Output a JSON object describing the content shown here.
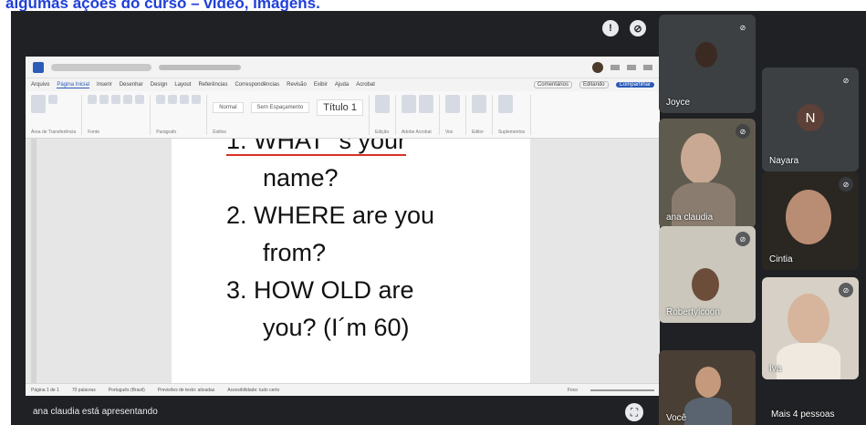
{
  "caption": "algumas ações do curso – vídeo, imagens.",
  "colors": {
    "caption_blue": "#1f3fd8",
    "meet_bg": "#202124",
    "word_blue": "#2b5bb8",
    "spell_red": "#d93025"
  },
  "share_icons": [
    "info-icon",
    "mic-off-icon"
  ],
  "word": {
    "tabs": [
      "Arquivo",
      "Página Inicial",
      "Inserir",
      "Desenhar",
      "Design",
      "Layout",
      "Referências",
      "Correspondências",
      "Revisão",
      "Exibir",
      "Ajuda",
      "Acrobat"
    ],
    "active_tab_index": 1,
    "comments_label": "Comentários",
    "editing_label": "Editando",
    "share_label": "Compartilhar",
    "styles": [
      "Normal",
      "Sem Espaçamento",
      "Título 1"
    ],
    "groups": [
      "Área de Transferência",
      "Fonte",
      "Parágrafo",
      "Estilos",
      "Edição",
      "Adobe Acrobat",
      "Voz",
      "Editor",
      "Suplementos"
    ],
    "doc_lines": [
      {
        "text": "1. WHAT ´s your",
        "underline": true,
        "indent": false
      },
      {
        "text": "name?",
        "underline": false,
        "indent": true
      },
      {
        "text": "2. WHERE are you",
        "underline": false,
        "indent": false
      },
      {
        "text": "from?",
        "underline": false,
        "indent": true
      },
      {
        "text": "3. HOW OLD are",
        "underline": false,
        "indent": false
      },
      {
        "text": "you? (I´m 60)",
        "underline": false,
        "indent": true
      }
    ],
    "status": {
      "page": "Página 1 de 1",
      "words": "70 palavras",
      "language": "Português (Brasil)",
      "text_predictions": "Previsões de texto: ativadas",
      "accessibility": "Acessibilidade: tudo certo",
      "focus": "Foco"
    }
  },
  "presenting_text": "ana claudia está apresentando",
  "participants": [
    {
      "name": "Joyce",
      "tile": "joyce"
    },
    {
      "name": "ana claudia",
      "tile": "ana"
    },
    {
      "name": "Robertylcoon",
      "tile": "rob"
    },
    {
      "name": "Você",
      "tile": "voce"
    },
    {
      "name": "Nayara",
      "tile": "nayara",
      "initial": "N"
    },
    {
      "name": "Cintia",
      "tile": "cintia"
    },
    {
      "name": "Iva",
      "tile": "iva"
    }
  ],
  "more_people": "Mais 4 pessoas"
}
